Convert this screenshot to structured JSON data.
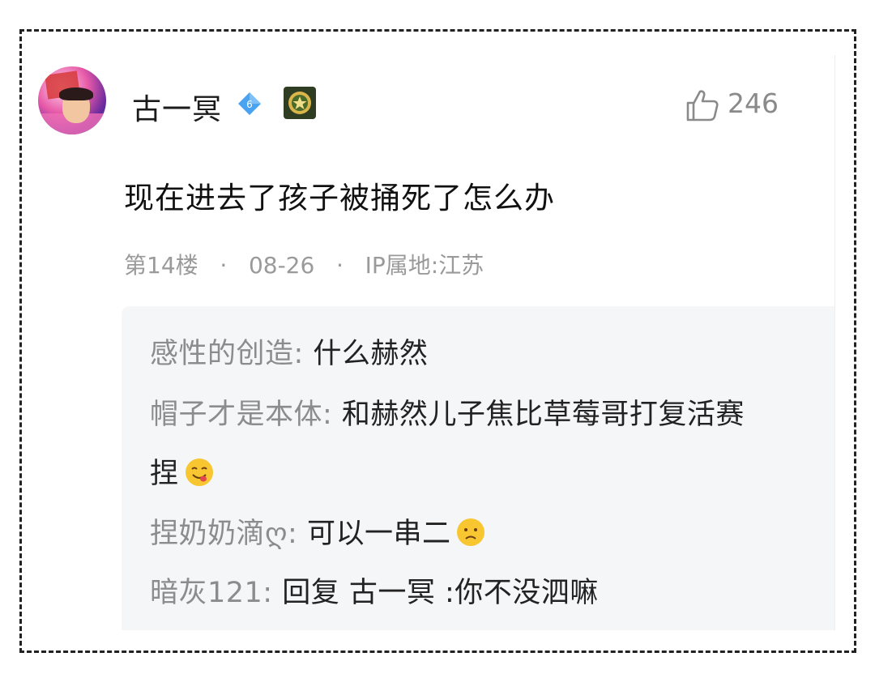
{
  "comment": {
    "user_name": "古一冥",
    "level": "6",
    "like_count": "246",
    "text": "现在进去了孩子被捅死了怎么办",
    "floor": "第14楼",
    "date": "08-26",
    "ip": "IP属地:江苏",
    "separator": "·"
  },
  "replies": [
    {
      "author": "感性的创造:",
      "text": " 什么赫然",
      "emoji": ""
    },
    {
      "author": "帽子才是本体:",
      "text": " 和赫然儿子焦比草莓哥打复活赛",
      "emoji": ""
    },
    {
      "author": "",
      "text": "捏",
      "emoji": "yum-emoji"
    },
    {
      "author": "捏奶奶滴ღ:",
      "text": " 可以一串二",
      "emoji": "worried-emoji"
    },
    {
      "author": "暗灰121:",
      "text": " 回复 古一冥 :你不没泗嘛",
      "emoji": ""
    }
  ],
  "colors": {
    "reply_bg": "#f5f6f8",
    "author_gray": "#8c8c8c",
    "level_badge": "#4aa3f0",
    "medal_bg": "#2f3d22"
  }
}
